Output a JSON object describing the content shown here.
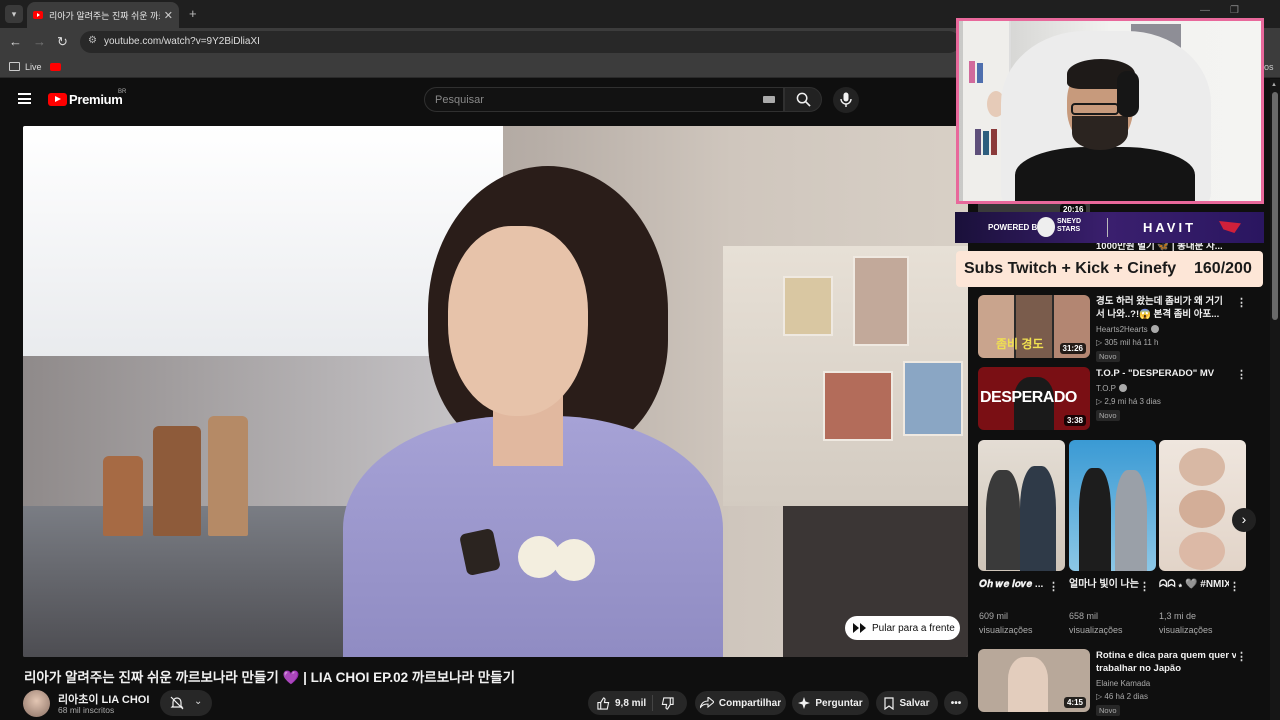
{
  "browser": {
    "tab_title": "리아가 알려주는 진짜 쉬운 까르",
    "url": "youtube.com/watch?v=9Y2BiDliaXI",
    "bookmarks": [
      {
        "label": "Live"
      }
    ],
    "bookmarks_right": "os"
  },
  "youtube": {
    "logo_text": "Premium",
    "logo_country": "BR",
    "search_placeholder": "Pesquisar"
  },
  "video": {
    "skip_label": "Pular para a frente",
    "title": "리아가 알려주는 진짜 쉬운 까르보나라 만들기",
    "title_emoji": "💜",
    "title_rest": " | LIA CHOI EP.02 까르보나라 만들기",
    "channel_name": "리아초이 LIA CHOI",
    "channel_subs": "68 mil inscritos",
    "likes": "9,8 mil",
    "actions": {
      "share": "Compartilhar",
      "ask": "Perguntar",
      "save": "Salvar",
      "more": "•••"
    }
  },
  "overlay": {
    "sponsor_powered": "POWERED BY",
    "sponsor_team": "SNEYD STARS",
    "sponsor_brand": "HAVIT",
    "subs_label": "Subs Twitch + Kick + Cinefy",
    "subs_count": "160/200"
  },
  "sidebar": {
    "peek_duration": "20:16",
    "peek_title": "1000만원 벌기 🦋 | 동대문 사...",
    "videos": [
      {
        "title_line1": "경도 하러 왔는데 좀비가 왜 거기",
        "title_line2": "서 나와..?!😱 본격 좀비 아포...",
        "channel": "Hearts2Hearts",
        "verified": true,
        "meta": "▷ 305 mil  há 11 h",
        "badge": "Novo",
        "duration": "31:26",
        "thumb_text": "좀비 경도",
        "thumb_color": "#2a2a2a"
      },
      {
        "title_line1": "T.O.P - \"DESPERADO\" MV",
        "title_line2": "",
        "channel": "T.O.P",
        "verified": true,
        "meta": "▷ 2,9 mi  há 3 dias",
        "badge": "Novo",
        "duration": "3:38",
        "thumb_text": "DESPERADO",
        "thumb_color": "#7a0f14"
      },
      {
        "title_line1": "Rotina e dica para quem quer vir",
        "title_line2": "trabalhar no Japão",
        "channel": "Elaine Kamada",
        "verified": false,
        "meta": "▷ 46  há 2 dias",
        "badge": "Novo",
        "duration": "4:15",
        "thumb_text": "",
        "thumb_color": "#b8a89a"
      }
    ],
    "shorts": [
      {
        "title": "𝑶𝒉 𝒘𝒆 𝒍𝒐𝒗𝒆 ...",
        "views1": "609 mil",
        "views2": "visualizações",
        "color": "#d9d1c6"
      },
      {
        "title": "얼마나 빛이 나는지✨ #...",
        "views1": "658 mil",
        "views2": "visualizações",
        "color": "#5aa7d6"
      },
      {
        "title": "ᗣᗣ ⁎ 🩶 #NMIXX #...",
        "views1": "1,3 mi de",
        "views2": "visualizações",
        "color": "#e9dcd3"
      }
    ]
  }
}
